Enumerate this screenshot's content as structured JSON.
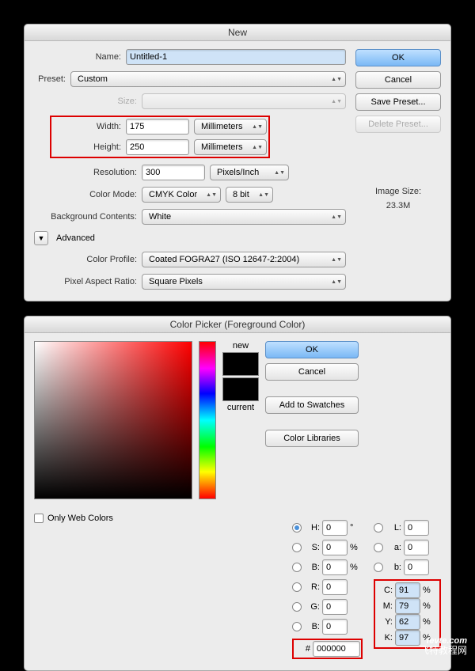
{
  "newDialog": {
    "title": "New",
    "name_label": "Name:",
    "name_value": "Untitled-1",
    "preset_label": "Preset:",
    "preset_value": "Custom",
    "size_label": "Size:",
    "width_label": "Width:",
    "width_value": "175",
    "width_unit": "Millimeters",
    "height_label": "Height:",
    "height_value": "250",
    "height_unit": "Millimeters",
    "resolution_label": "Resolution:",
    "resolution_value": "300",
    "resolution_unit": "Pixels/Inch",
    "colormode_label": "Color Mode:",
    "colormode_value": "CMYK Color",
    "bitdepth_value": "8 bit",
    "bg_label": "Background Contents:",
    "bg_value": "White",
    "advanced_label": "Advanced",
    "profile_label": "Color Profile:",
    "profile_value": "Coated FOGRA27 (ISO 12647-2:2004)",
    "aspect_label": "Pixel Aspect Ratio:",
    "aspect_value": "Square Pixels",
    "ok": "OK",
    "cancel": "Cancel",
    "save_preset": "Save Preset...",
    "delete_preset": "Delete Preset...",
    "image_size_label": "Image Size:",
    "image_size_value": "23.3M"
  },
  "cp": {
    "title": "Color Picker (Foreground Color)",
    "new_label": "new",
    "current_label": "current",
    "only_web": "Only Web Colors",
    "ok": "OK",
    "cancel": "Cancel",
    "add_swatches": "Add to Swatches",
    "color_libraries": "Color Libraries",
    "h_label": "H:",
    "h_val": "0",
    "h_unit": "°",
    "s_label": "S:",
    "s_val": "0",
    "s_unit": "%",
    "b1_label": "B:",
    "b1_val": "0",
    "b1_unit": "%",
    "r_label": "R:",
    "r_val": "0",
    "g_label": "G:",
    "g_val": "0",
    "b2_label": "B:",
    "b2_val": "0",
    "l_label": "L:",
    "l_val": "0",
    "a_label": "a:",
    "a_val": "0",
    "lab_b_label": "b:",
    "lab_b_val": "0",
    "c_label": "C:",
    "c_val": "91",
    "c_unit": "%",
    "m_label": "M:",
    "m_val": "79",
    "m_unit": "%",
    "y_label": "Y:",
    "y_val": "62",
    "y_unit": "%",
    "k_label": "K:",
    "k_val": "97",
    "k_unit": "%",
    "hex_label": "#",
    "hex_val": "000000"
  },
  "watermark": {
    "domain": "fevte.com",
    "cn": "飞特教程网"
  }
}
